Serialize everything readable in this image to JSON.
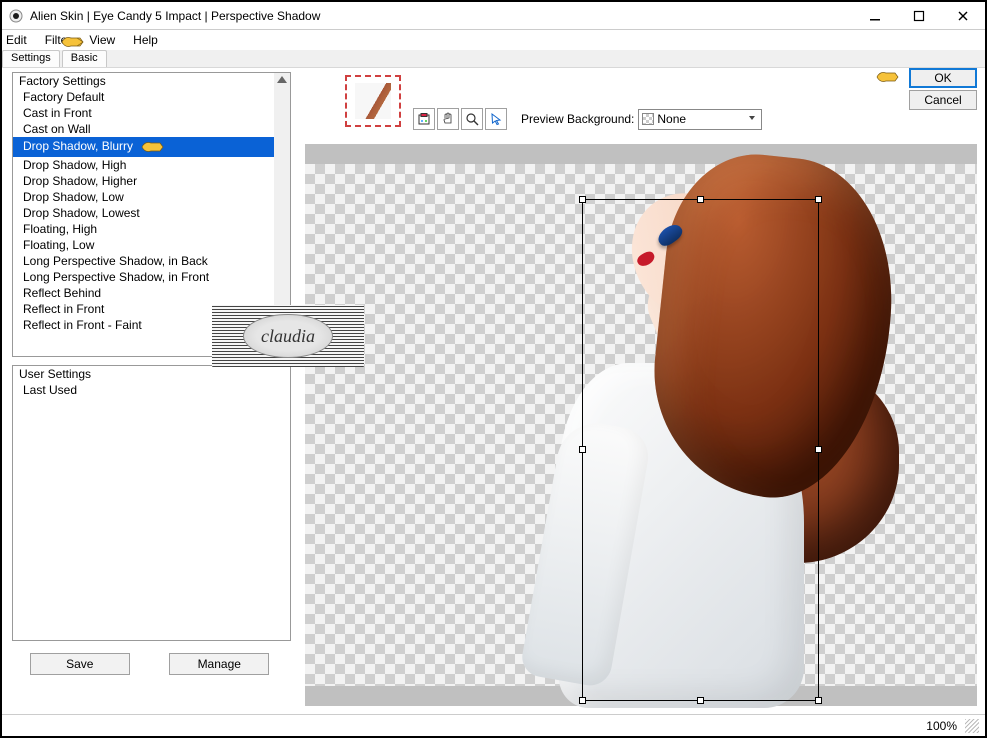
{
  "window": {
    "title": "Alien Skin | Eye Candy 5 Impact | Perspective Shadow"
  },
  "menu": {
    "edit": "Edit",
    "filter": "Filter",
    "view": "View",
    "help": "Help"
  },
  "tabs": {
    "settings": "Settings",
    "basic": "Basic"
  },
  "factory": {
    "header": "Factory Settings",
    "items": [
      "Factory Default",
      "Cast in Front",
      "Cast on Wall",
      "Drop Shadow, Blurry",
      "Drop Shadow, High",
      "Drop Shadow, Higher",
      "Drop Shadow, Low",
      "Drop Shadow, Lowest",
      "Floating, High",
      "Floating, Low",
      "Long Perspective Shadow, in Back",
      "Long Perspective Shadow, in Front",
      "Reflect Behind",
      "Reflect in Front",
      "Reflect in Front - Faint"
    ],
    "selected_index": 3
  },
  "user": {
    "header": "User Settings",
    "items": [
      "Last Used"
    ]
  },
  "left_buttons": {
    "save": "Save",
    "manage": "Manage"
  },
  "toolbar": {
    "preview_bg_label": "Preview Background:",
    "preview_bg_value": "None"
  },
  "actions": {
    "ok": "OK",
    "cancel": "Cancel"
  },
  "status": {
    "zoom": "100%"
  },
  "watermark": {
    "text": "claudia"
  }
}
